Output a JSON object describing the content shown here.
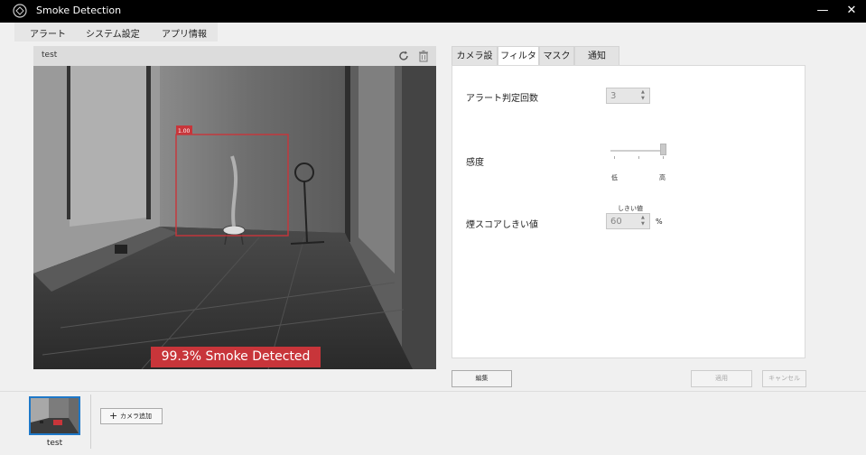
{
  "window": {
    "title": "Smoke Detection",
    "minimize_glyph": "—",
    "close_glyph": "✕"
  },
  "menu": {
    "items": [
      "アラート",
      "システム設定",
      "アプリ情報"
    ]
  },
  "camera": {
    "name": "test",
    "detection": {
      "box_label": "1.00",
      "banner": "99.3% Smoke Detected",
      "banner_color": "#c8353a"
    }
  },
  "tabs": {
    "items": [
      "カメラ設定",
      "フィルタ",
      "マスク",
      "通知"
    ],
    "active": "フィルタ"
  },
  "filter": {
    "alert_count_label": "アラート判定回数",
    "alert_count_value": "3",
    "sensitivity_label": "感度",
    "sensitivity_low": "低",
    "sensitivity_high": "高",
    "sensitivity_level": 1.0,
    "score_threshold_label": "煙スコアしきい値",
    "score_threshold_caption": "しきい値",
    "score_threshold_value": "60",
    "score_unit": "%"
  },
  "buttons": {
    "edit": "編集",
    "apply": "適用",
    "cancel": "キャンセル"
  },
  "camera_list": {
    "items": [
      {
        "name": "test"
      }
    ],
    "add_label": "カメラ追加",
    "add_icon": "plus-icon"
  },
  "icons": {
    "refresh": "refresh-icon",
    "delete": "trash-icon",
    "app": "app-logo-icon"
  },
  "colors": {
    "accent": "#1e78c8",
    "titlebar": "#000000",
    "detection": "#c8353a"
  }
}
